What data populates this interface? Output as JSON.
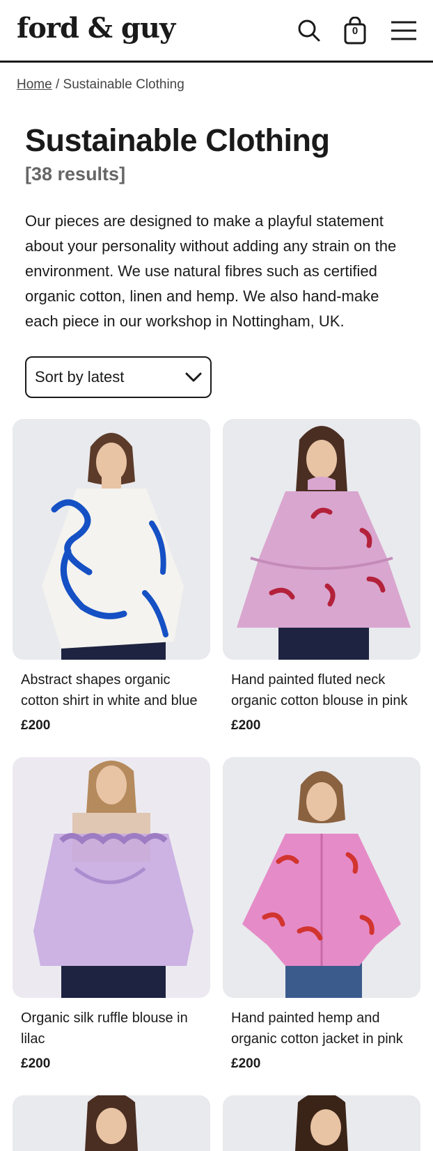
{
  "header": {
    "logo": "ford & guy",
    "cart_count": "0"
  },
  "breadcrumb": {
    "home": "Home",
    "separator": " / ",
    "current": "Sustainable Clothing"
  },
  "page": {
    "title": "Sustainable Clothing",
    "results": "[38 results]",
    "intro": "Our pieces are designed to make a playful statement about your personality without adding any strain on the environment. We use natural fibres such as certified organic cotton, linen and hemp. We also hand-make each piece in our workshop in Nottingham, UK."
  },
  "sort": {
    "selected": "Sort by latest"
  },
  "products": [
    {
      "title": "Abstract shapes organic cotton shirt in white and blue",
      "price": "£200",
      "garment": "#f4f3ef",
      "accent": "#1550c4"
    },
    {
      "title": "Hand painted fluted neck organic cotton blouse in pink",
      "price": "£200",
      "garment": "#d9a6cf",
      "accent": "#b3213a"
    },
    {
      "title": "Organic silk ruffle blouse in lilac",
      "price": "£200",
      "garment": "#c7a9e0",
      "accent": "#9d7cc4"
    },
    {
      "title": "Hand painted hemp and organic cotton jacket in pink",
      "price": "£200",
      "garment": "#e58cc8",
      "accent": "#d2342f"
    }
  ],
  "colors": {
    "text": "#1a1a1a",
    "muted": "#666666",
    "image_bg": "#e6e7ec"
  }
}
